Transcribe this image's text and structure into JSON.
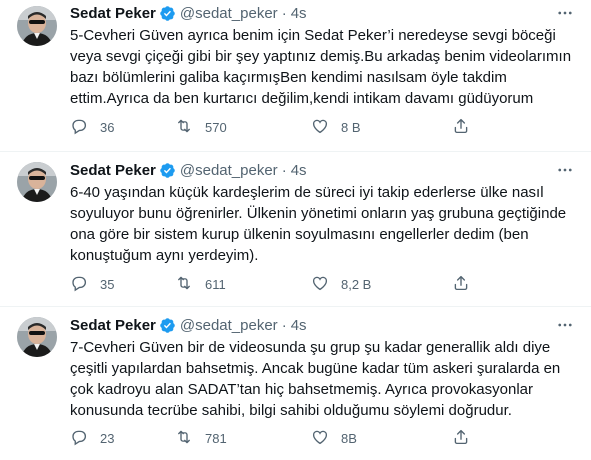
{
  "tweets": [
    {
      "name": "Sedat Peker",
      "handle": "@sedat_peker",
      "separator": "·",
      "time": "4s",
      "text_lines": [
        "5-Cevheri Güven ayrıca benim için Sedat Peker’i neredeyse sevgi böceği",
        "veya sevgi çiçeği gibi bir şey yaptınız demiş.Bu arkadaş benim videolarımın",
        "bazı bölümlerini galiba kaçırmışBen kendimi nasılsam öyle takdim",
        "ettim.Ayrıca da ben kurtarıcı değilim,kendi intikam davamı güdüyorum"
      ],
      "replies": "36",
      "retweets": "570",
      "likes": "8 B"
    },
    {
      "name": "Sedat Peker",
      "handle": "@sedat_peker",
      "separator": "·",
      "time": "4s",
      "text_lines": [
        "6-40 yaşından küçük kardeşlerim de süreci iyi takip ederlerse ülke nasıl",
        "soyuluyor bunu öğrenirler. Ülkenin yönetimi onların yaş grubuna geçtiğinde",
        "ona göre bir sistem kurup ülkenin soyulmasını engellerler dedim (ben",
        "konuştuğum aynı yerdeyim)."
      ],
      "replies": "35",
      "retweets": "611",
      "likes": "8,2 B"
    },
    {
      "name": "Sedat Peker",
      "handle": "@sedat_peker",
      "separator": "·",
      "time": "4s",
      "text_lines": [
        "7-Cevheri Güven bir de videosunda şu grup şu kadar generallik aldı diye",
        "çeşitli yapılardan bahsetmiş. Ancak bugüne kadar tüm askeri şuralarda en",
        "çok kadroyu alan SADAT’tan hiç bahsetmemiş. Ayrıca provokasyonlar",
        "konusunda tecrübe sahibi, bilgi sahibi olduğumu söylemi doğrudur."
      ],
      "replies": "23",
      "retweets": "781",
      "likes": "8B"
    }
  ],
  "icons": {
    "verified": "verified-badge-icon",
    "more": "more-horizontal-icon",
    "reply": "reply-icon",
    "retweet": "retweet-icon",
    "like": "heart-icon",
    "share": "share-icon"
  },
  "colors": {
    "verified": "#1d9bf0",
    "text": "#0f1419",
    "secondary": "#536471",
    "divider": "#eff3f4"
  }
}
